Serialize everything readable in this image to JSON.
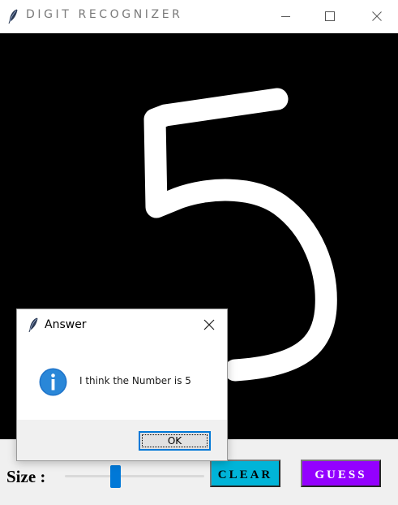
{
  "window": {
    "title": "DIGIT RECOGNIZER",
    "icon": "feather-icon",
    "controls": [
      "minimize-icon",
      "maximize-icon",
      "close-icon"
    ]
  },
  "canvas": {
    "background": "#000000",
    "stroke_color": "#ffffff",
    "drawn_digit": "5"
  },
  "controls": {
    "size_label": "Size :",
    "slider_value_fraction": 0.35,
    "clear_label": "CLEAR",
    "guess_label": "GUESS",
    "clear_color": "#00b4d8",
    "guess_color": "#9400ff"
  },
  "dialog": {
    "title": "Answer",
    "icon": "feather-icon",
    "message_icon": "info-icon",
    "message": "I think the Number is 5",
    "ok_label": "OK",
    "accent": "#0078d7"
  }
}
